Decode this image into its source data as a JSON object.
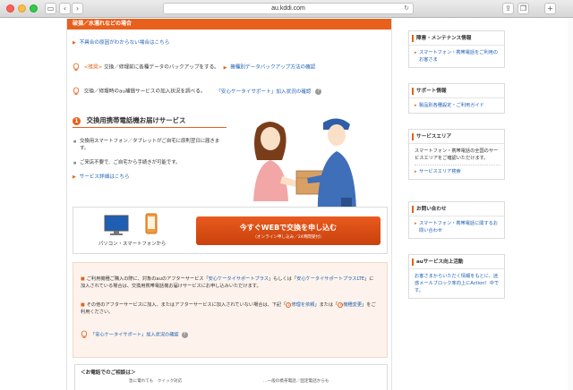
{
  "browser": {
    "url": "au.kddi.com",
    "back_icon": "chevron-left",
    "forward_icon": "chevron-right"
  },
  "main": {
    "header": "破損／水濡れなどの場合",
    "unknown_cause_link": "不具合の原因がわからない場合はこちら",
    "backup_prefix": "<推奨>",
    "backup_text": "交換／修理前に各種データのバックアップをする。",
    "backup_link": "機種別データバックアップ方法の確認",
    "warranty_text": "交換／修理時のau補償サービスの加入状況を調べる。",
    "warranty_link": "「安心ケータイサポート」加入状況の確認",
    "section_number": "1",
    "section_title": "交換用携帯電話機お届けサービス",
    "bullets": [
      "交換用スマートフォン／タブレットがご自宅に原則翌日に届きます。",
      "ご来店不要で、ご自宅から手続きが可能です。"
    ],
    "details_link": "サービス詳細はこちら",
    "cta_device_label": "パソコン・スマートフォンから",
    "cta_main": "今すぐWEBで交換を申し込む",
    "cta_sub": "（オンライン申し込み／24時間受付）",
    "note_p1_pre": "ご利用機種ご購入の際に、対象のauのアフターサービス「",
    "note_p1_link1": "安心ケータイサポートプラス",
    "note_p1_mid": "」もしくは「",
    "note_p1_link2": "安心ケータイサポートプラスLTE",
    "note_p1_post": "」に加入されている場合は、交換用携帯電話機お届けサービスにお申し込みいただけます。",
    "note_p2_pre": "その他のアフターサービスに加入、またはアフターサービスに加入されていない場合は、下記「",
    "note_p2_num1": "2",
    "note_p2_link1": "修理を依頼",
    "note_p2_mid": "」または「",
    "note_p2_num2": "3",
    "note_p2_link2": "機種変更",
    "note_p2_post": "」をご利用ください。",
    "note_link": "「安心ケータイサポート」加入状況の確認",
    "phone_title": "＜お電話でのご相談は＞",
    "phone_sub": "急に電れても　クイック対応",
    "phone_sub2": "…一般の携帯電話／固定電話からも"
  },
  "sidebar": {
    "boxes": [
      {
        "title": "障害・メンテナンス情報",
        "items": [
          "スマートフォン・携帯電話をご利用のお客さま"
        ]
      },
      {
        "title": "サポート情報",
        "items": [
          "製品別各種設定・ご利用ガイド"
        ]
      },
      {
        "title": "サービスエリア",
        "desc": "スマートフォン・携帯電話の全国のサービスエリアをご確認いただけます。",
        "items": [
          "サービスエリア検索"
        ]
      },
      {
        "title": "お問い合わせ",
        "items": [
          "スマートフォン・携帯電話に関するお問い合わせ"
        ]
      },
      {
        "title": "auサービス向上活動",
        "desc": "お客さまからいただく情報をもとに、迷惑メールブロック率向上にAction！中です。"
      }
    ]
  },
  "colors": {
    "accent": "#e8601c",
    "link": "#1d5fb3",
    "note_bg": "#fdf3ec"
  }
}
